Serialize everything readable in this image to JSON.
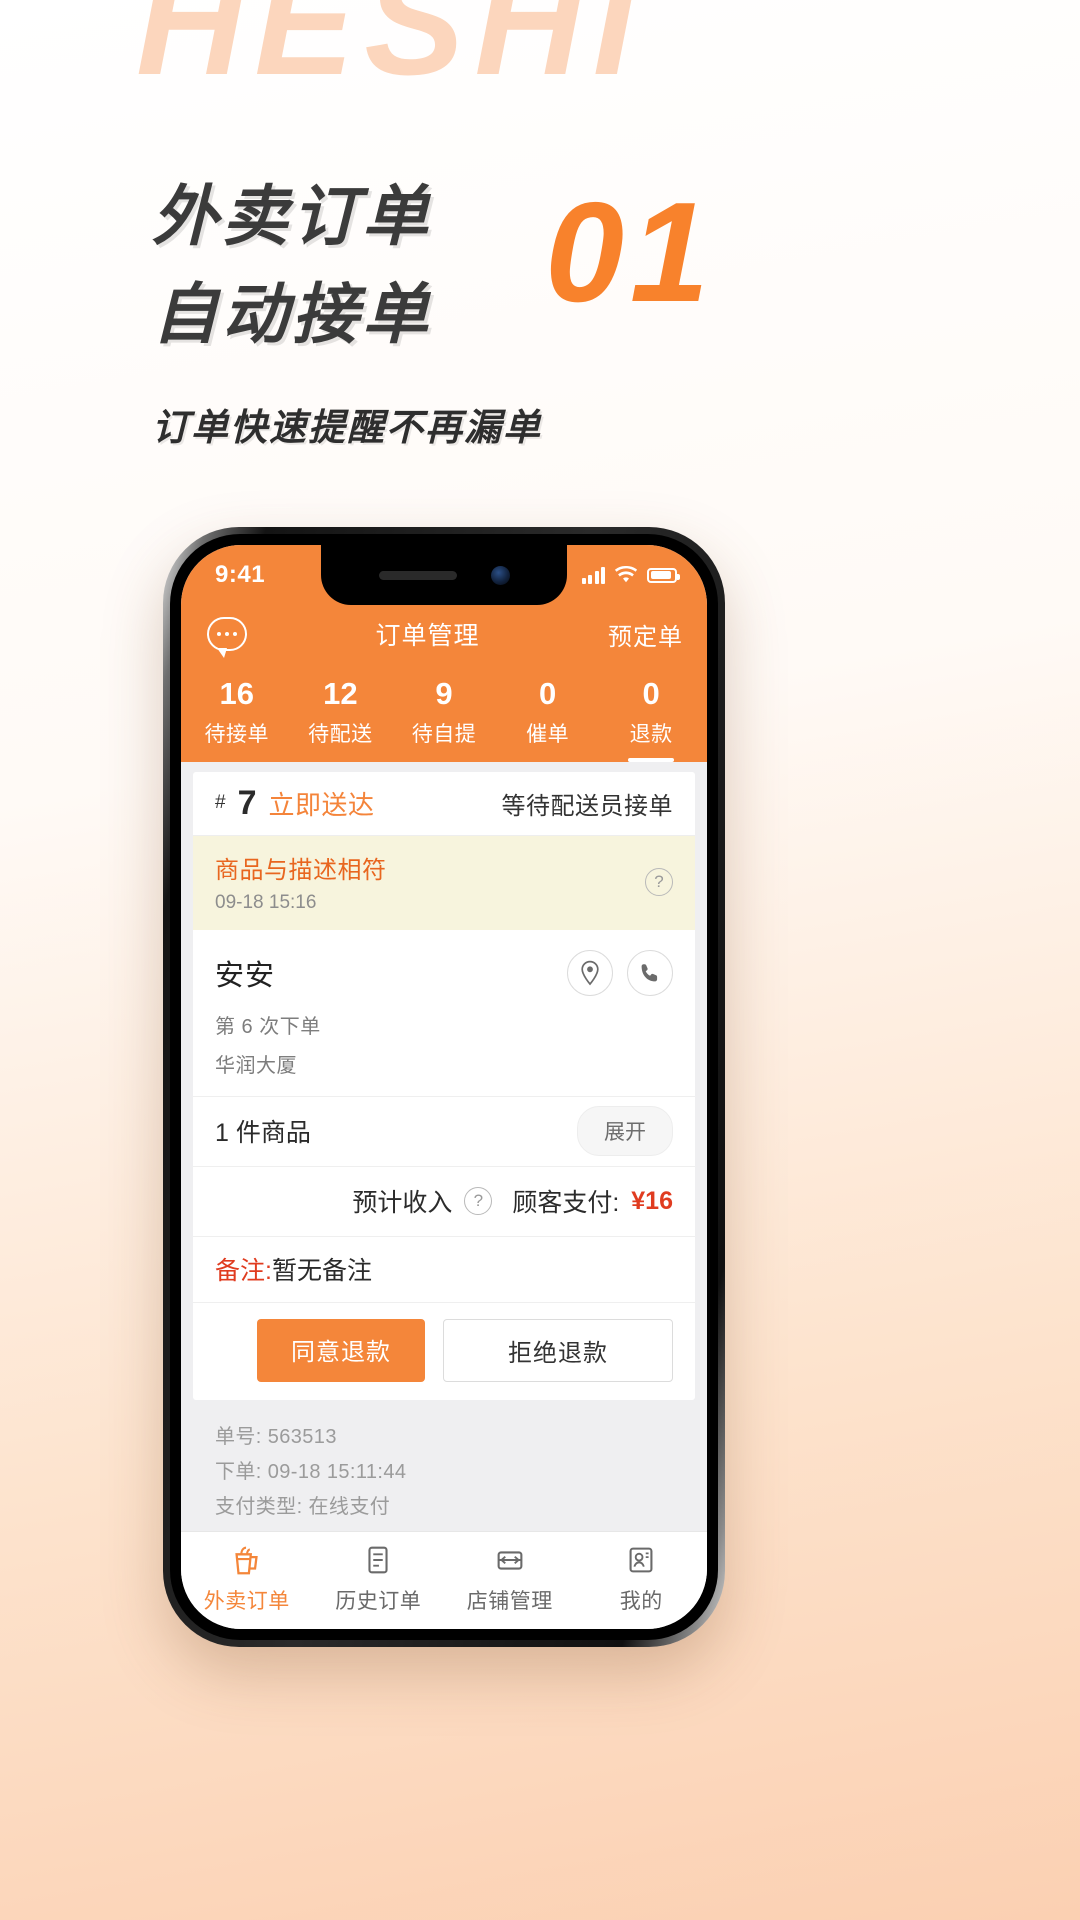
{
  "watermark": {
    "text": "HESHI"
  },
  "headline": {
    "line1": "外卖订单",
    "line2": "自动接单",
    "subtitle": "订单快速提醒不再漏单",
    "step": "01"
  },
  "colors": {
    "brand_orange": "#f4863a",
    "accent_orange": "#f8822c",
    "price_red": "#e03c20",
    "banner_bg": "#f7f4dd",
    "watermark": "#fcd6bd"
  },
  "phone": {
    "status_bar": {
      "time": "9:41",
      "signal": "signal-bars-icon",
      "wifi": "wifi-icon",
      "battery": "battery-icon"
    },
    "navbar": {
      "left_icon": "chat-bubble-icon",
      "title": "订单管理",
      "right_label": "预定单"
    },
    "stats": [
      {
        "count": "16",
        "label": "待接单",
        "active": false
      },
      {
        "count": "12",
        "label": "待配送",
        "active": false
      },
      {
        "count": "9",
        "label": "待自提",
        "active": false
      },
      {
        "count": "0",
        "label": "催单",
        "active": false
      },
      {
        "count": "0",
        "label": "退款",
        "active": true
      }
    ],
    "order": {
      "hash": "#",
      "sequence": "7",
      "delivery_type": "立即送达",
      "status": "等待配送员接单",
      "refund_banner": {
        "reason": "商品与描述相符",
        "time": "09-18 15:16",
        "help_icon": "question-mark-icon"
      },
      "customer": {
        "name": "安安",
        "order_times": "第 6 次下单",
        "address": "华润大厦",
        "location_icon": "location-pin-icon",
        "phone_icon": "phone-icon"
      },
      "goods": {
        "count_label": "1 件商品",
        "expand_label": "展开"
      },
      "income": {
        "income_label": "预计收入",
        "help_icon": "question-mark-icon",
        "pay_label": "顾客支付:",
        "pay_amount": "¥16"
      },
      "note": {
        "key": "备注:",
        "value": "暂无备注"
      },
      "actions": {
        "primary": "同意退款",
        "secondary": "拒绝退款"
      },
      "meta": {
        "order_no": "单号: 563513",
        "placed_at": "下单: 09-18 15:11:44",
        "pay_type": "支付类型: 在线支付"
      }
    },
    "tabbar": [
      {
        "icon": "takeout-cup-icon",
        "label": "外卖订单",
        "active": true
      },
      {
        "icon": "history-order-icon",
        "label": "历史订单",
        "active": false
      },
      {
        "icon": "shop-manage-icon",
        "label": "店铺管理",
        "active": false
      },
      {
        "icon": "profile-icon",
        "label": "我的",
        "active": false
      }
    ]
  }
}
